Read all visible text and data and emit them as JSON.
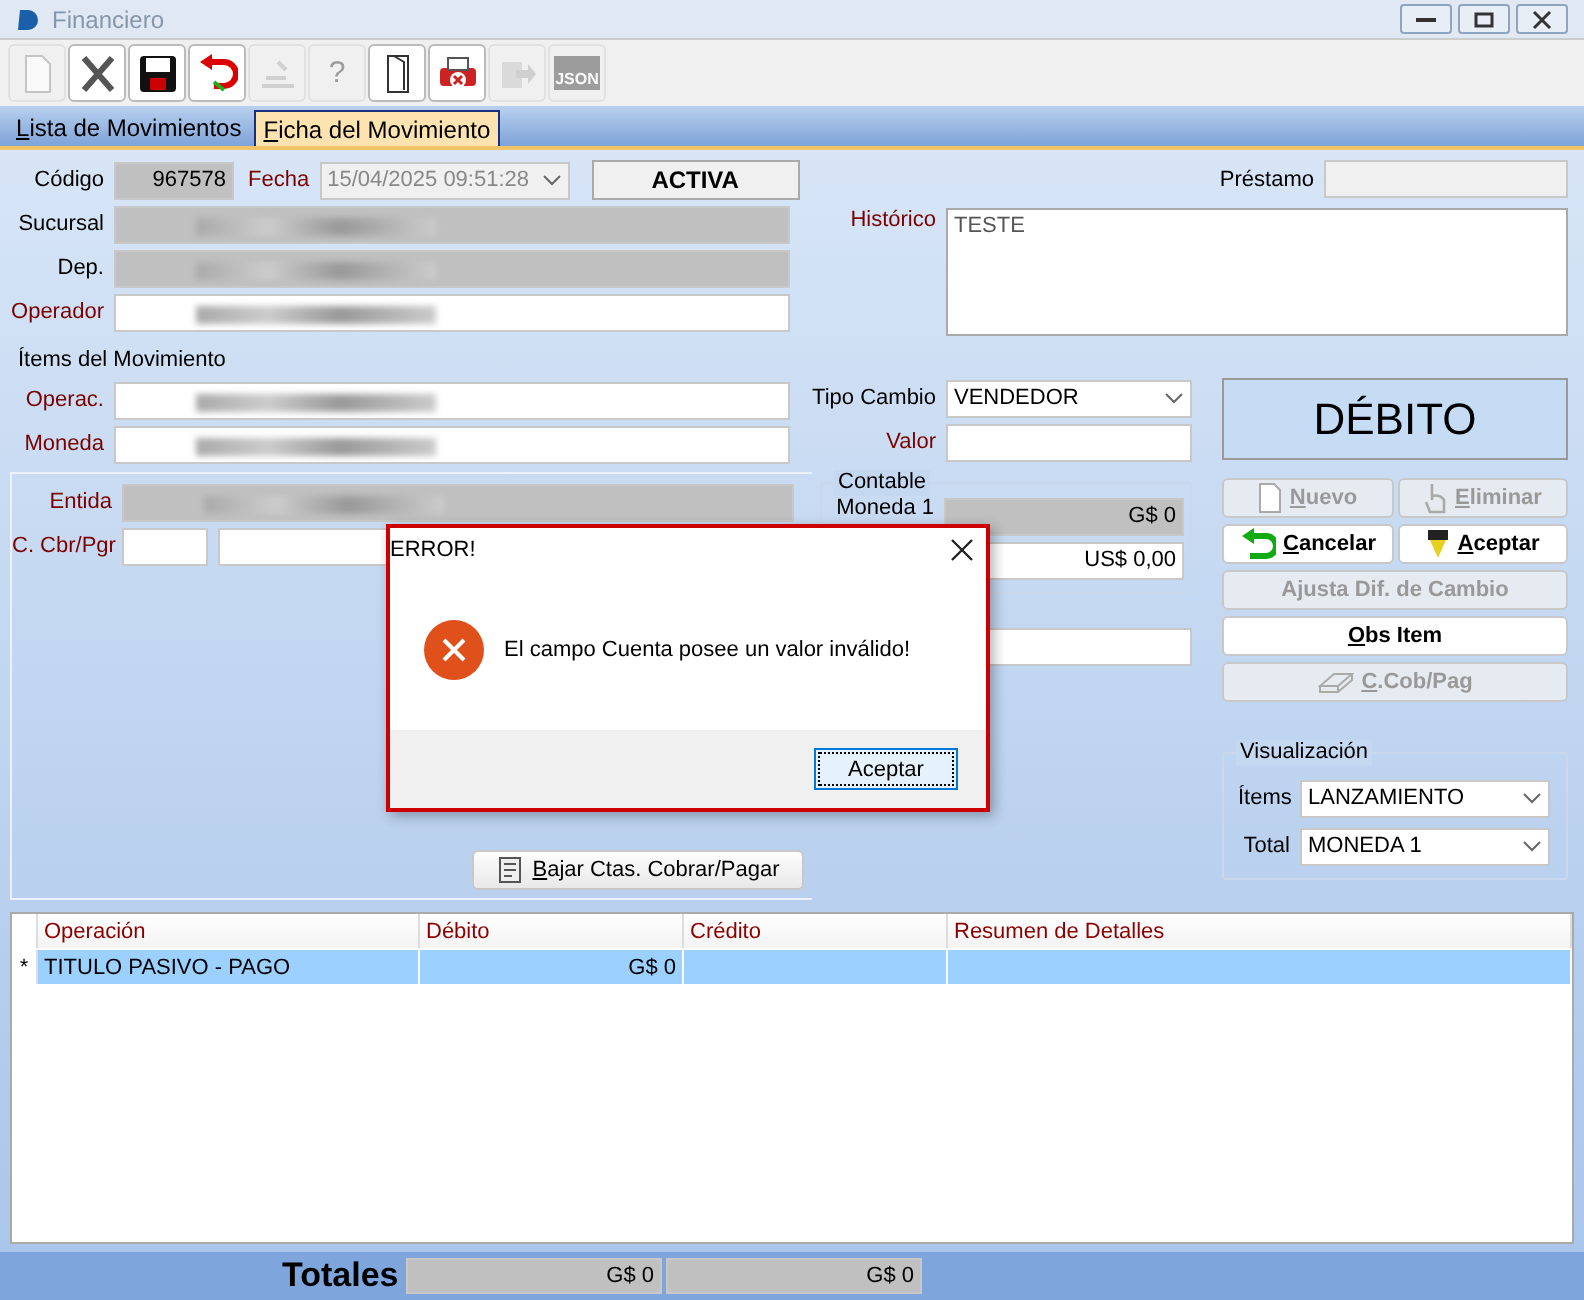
{
  "window": {
    "title": "Financiero"
  },
  "toolbar": [
    {
      "kind": "new",
      "disabled": true
    },
    {
      "kind": "delete",
      "disabled": false
    },
    {
      "kind": "save",
      "disabled": false
    },
    {
      "kind": "undo",
      "disabled": false
    },
    {
      "kind": "tools",
      "disabled": true
    },
    {
      "kind": "help",
      "label": "?",
      "disabled": true
    },
    {
      "kind": "exit",
      "disabled": false
    },
    {
      "kind": "print",
      "disabled": false
    },
    {
      "kind": "export",
      "disabled": true
    },
    {
      "kind": "json",
      "label": "JSON",
      "disabled": true
    }
  ],
  "tabs": [
    {
      "label": "Lista de Movimientos",
      "selected": false,
      "mnemonic": true
    },
    {
      "label": "Ficha del Movimiento",
      "selected": true,
      "mnemonic": true
    }
  ],
  "codigo": {
    "label": "Código",
    "value": "967578"
  },
  "fecha": {
    "label": "Fecha",
    "value": "15/04/2025 09:51:28",
    "required": true,
    "disabled": true
  },
  "status": "ACTIVA",
  "header_fields": [
    {
      "label": "Sucursal",
      "required": false,
      "disabled": true,
      "redacted": true
    },
    {
      "label": "Dep.",
      "required": false,
      "disabled": true,
      "redacted": true
    },
    {
      "label": "Operador",
      "required": true,
      "disabled": false,
      "redacted": true
    }
  ],
  "items_title": "Ítems del Movimiento",
  "item_fields": [
    {
      "label": "Operac.",
      "required": true,
      "disabled": false,
      "redacted": true
    },
    {
      "label": "Moneda",
      "required": true,
      "disabled": false,
      "redacted": true
    }
  ],
  "entidad": {
    "label": "Entida",
    "required": true,
    "disabled": true,
    "redacted": true
  },
  "cuenta": {
    "label": "C. Cbr/Pgr",
    "required": true
  },
  "bajar_button": {
    "label": "Bajar Ctas. Cobrar/Pagar",
    "mnemonic": true
  },
  "prestamo": {
    "label": "Préstamo"
  },
  "historico": {
    "label": "Histórico",
    "required": true,
    "value": "TESTE"
  },
  "tipo_cambio": {
    "label": "Tipo Cambio",
    "required": false,
    "value": "VENDEDOR"
  },
  "valor": {
    "label": "Valor",
    "required": true
  },
  "contable": {
    "title": "Contable",
    "label": "Moneda 1",
    "amount": "G$ 0",
    "amount_2": "US$ 0,00"
  },
  "movement_type": "DÉBITO",
  "actions": [
    {
      "label": "Nuevo",
      "kind": "page",
      "disabled": true,
      "mnemonic": true,
      "wide": false
    },
    {
      "label": "Eliminar",
      "kind": "hand",
      "disabled": true,
      "mnemonic": true,
      "wide": false
    },
    {
      "label": "Cancelar",
      "kind": "return",
      "disabled": false,
      "mnemonic": true,
      "wide": false
    },
    {
      "label": "Aceptar",
      "kind": "pen",
      "disabled": false,
      "mnemonic": true,
      "wide": false
    },
    {
      "label": "Ajusta Dif. de Cambio",
      "kind": "text",
      "disabled": true,
      "mnemonic": false,
      "wide": true
    },
    {
      "label": "Obs Item",
      "kind": "text",
      "disabled": false,
      "mnemonic": true,
      "wide": true
    },
    {
      "label": "C.Cob/Pag",
      "kind": "eraser",
      "disabled": true,
      "mnemonic": true,
      "wide": true
    }
  ],
  "visualizacion": {
    "title": "Visualización",
    "rows": [
      {
        "label": "Ítems",
        "value": "LANZAMIENTO"
      },
      {
        "label": "Total",
        "value": "MONEDA 1"
      }
    ]
  },
  "grid": {
    "columns": [
      "Operación",
      "Débito",
      "Crédito",
      "Resumen de Detalles"
    ],
    "rows": [
      {
        "marker": "*",
        "selected": true,
        "cells": [
          "TITULO PASIVO - PAGO",
          "G$ 0"
        ]
      }
    ]
  },
  "totals": {
    "label": "Totales",
    "values": [
      "G$ 0",
      "G$ 0"
    ]
  },
  "dialog": {
    "title": "ERROR!",
    "message": "El campo Cuenta posee un valor inválido!",
    "button": "Aceptar"
  }
}
